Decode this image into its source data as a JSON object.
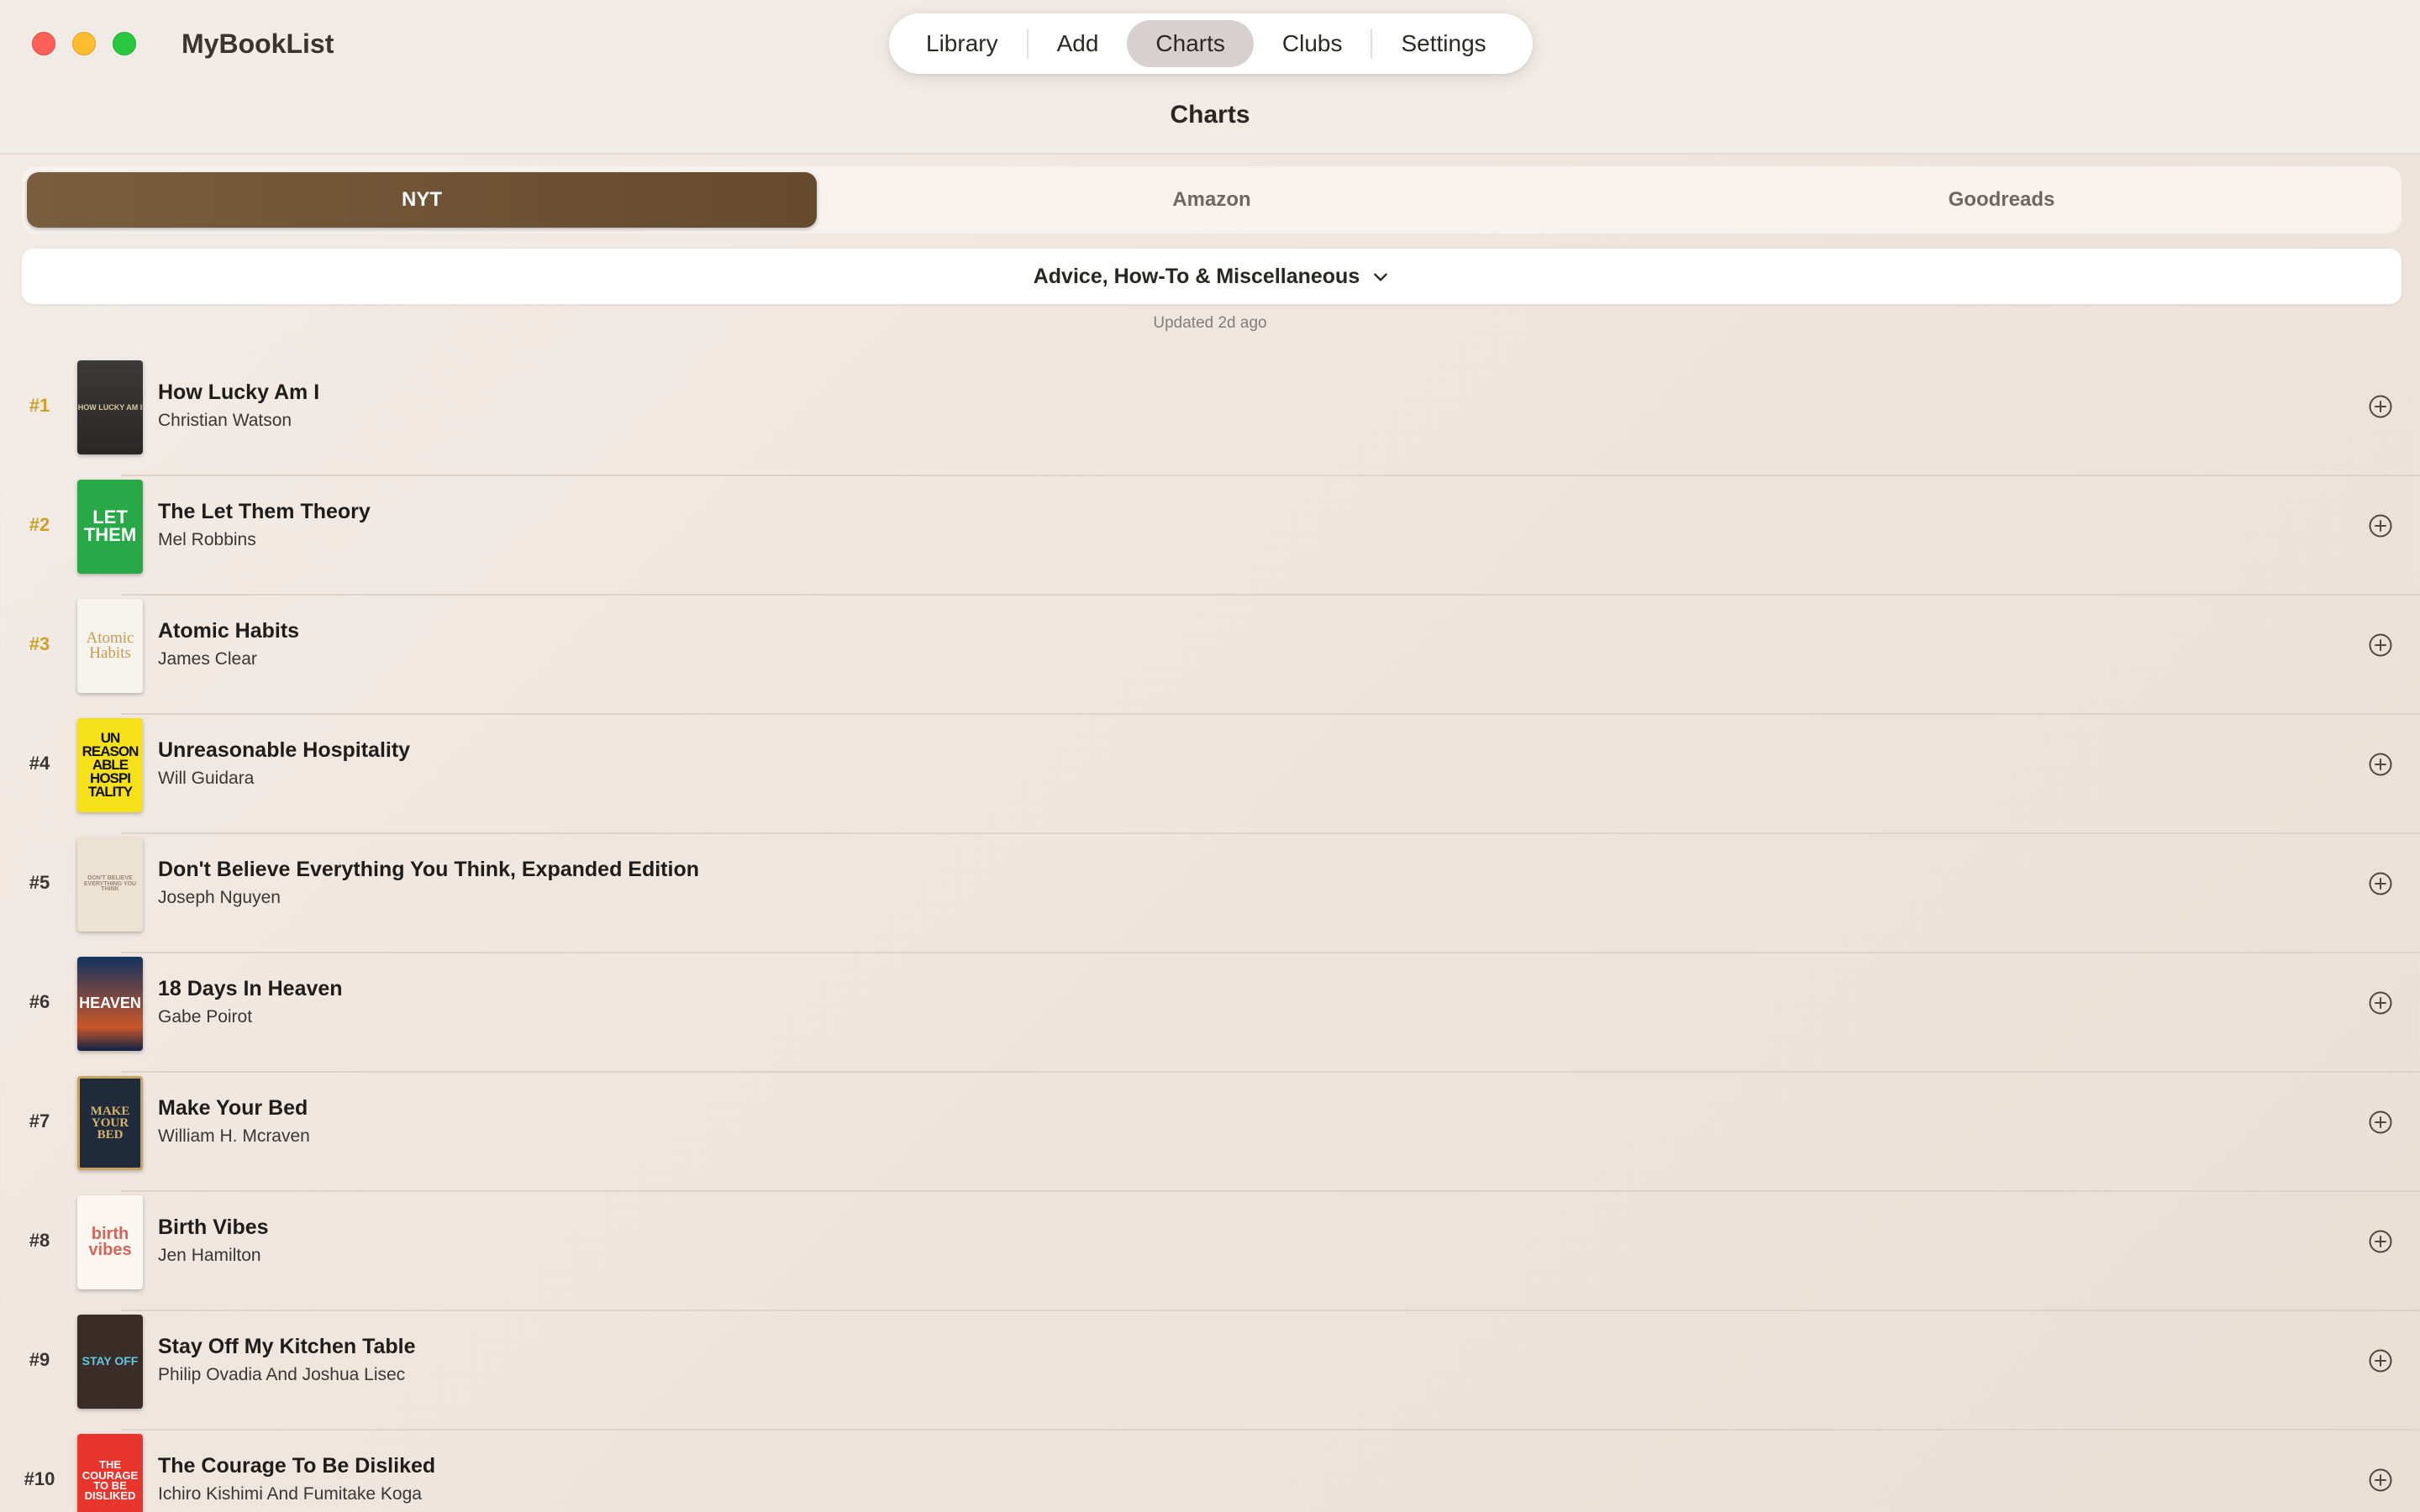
{
  "app": {
    "title": "MyBookList",
    "nav": [
      "Library",
      "Add",
      "Charts",
      "Clubs",
      "Settings"
    ],
    "active_nav": "Charts",
    "page_title": "Charts"
  },
  "sources": {
    "tabs": [
      "NYT",
      "Amazon",
      "Goodreads"
    ],
    "active": "NYT"
  },
  "category": {
    "selected": "Advice, How-To & Miscellaneous",
    "icon": "chevron-down-icon"
  },
  "updated": "Updated 2d ago",
  "books": [
    {
      "rank": "#1",
      "title": "How Lucky Am I",
      "author": "Christian Watson",
      "cover_text": "HOW LUCKY AM I"
    },
    {
      "rank": "#2",
      "title": "The Let Them Theory",
      "author": "Mel Robbins",
      "cover_text": "LET THEM"
    },
    {
      "rank": "#3",
      "title": "Atomic Habits",
      "author": "James Clear",
      "cover_text": "Atomic Habits"
    },
    {
      "rank": "#4",
      "title": "Unreasonable Hospitality",
      "author": "Will Guidara",
      "cover_text": "UN REASON ABLE HOSPI TALITY"
    },
    {
      "rank": "#5",
      "title": "Don't Believe Everything You Think, Expanded Edition",
      "author": "Joseph Nguyen",
      "cover_text": "DON'T BELIEVE EVERYTHING YOU THINK"
    },
    {
      "rank": "#6",
      "title": "18 Days In Heaven",
      "author": "Gabe Poirot",
      "cover_text": "HEAVEN"
    },
    {
      "rank": "#7",
      "title": "Make Your Bed",
      "author": "William H. Mcraven",
      "cover_text": "MAKE YOUR BED"
    },
    {
      "rank": "#8",
      "title": "Birth Vibes",
      "author": "Jen Hamilton",
      "cover_text": "birth vibes"
    },
    {
      "rank": "#9",
      "title": "Stay Off My Kitchen Table",
      "author": "Philip Ovadia And Joshua Lisec",
      "cover_text": "STAY OFF"
    },
    {
      "rank": "#10",
      "title": "The Courage To Be Disliked",
      "author": "Ichiro Kishimi And Fumitake Koga",
      "cover_text": "THE COURAGE TO BE DISLIKED"
    }
  ],
  "colors": {
    "accent": "#6f5436",
    "top_rank": "#c9a227",
    "background": "#efe6df"
  }
}
